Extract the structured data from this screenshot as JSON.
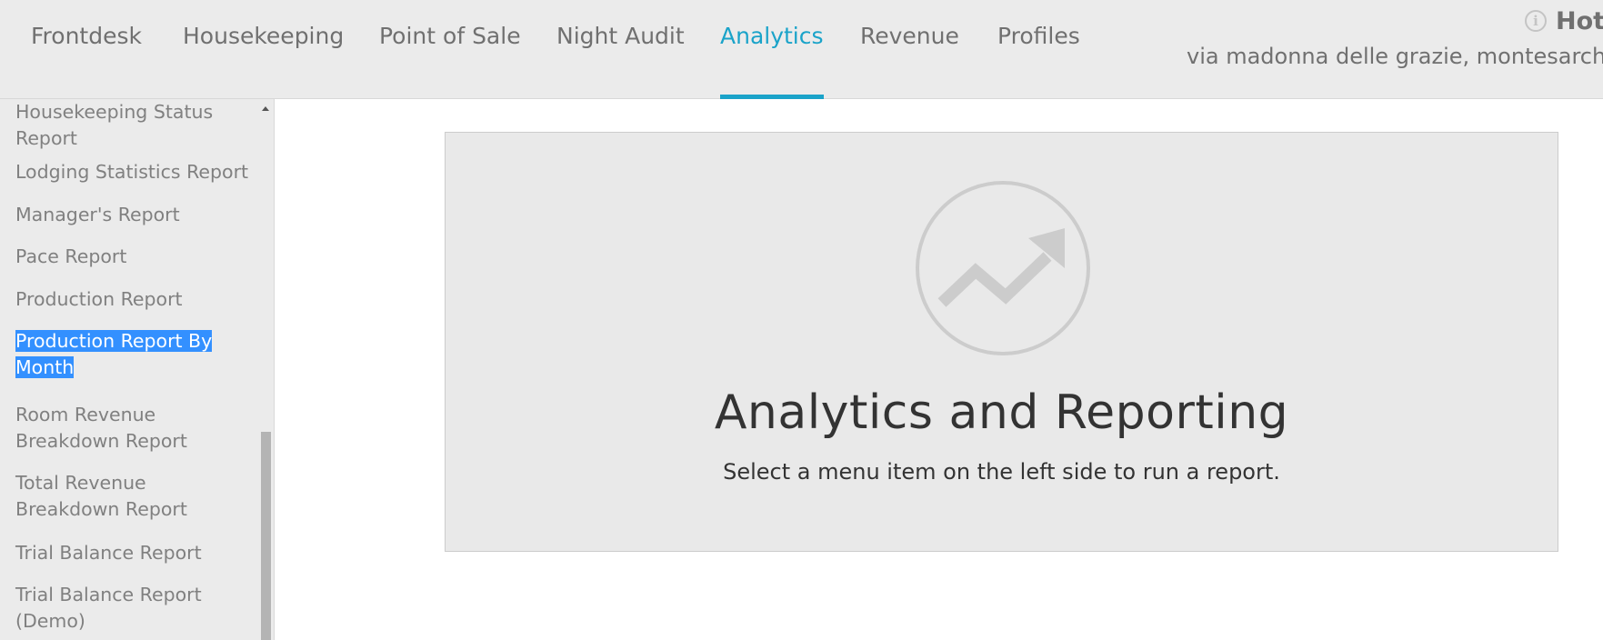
{
  "nav": {
    "tabs": [
      {
        "label": "Frontdesk",
        "active": false
      },
      {
        "label": "Housekeeping",
        "active": false
      },
      {
        "label": "Point of Sale",
        "active": false
      },
      {
        "label": "Night Audit",
        "active": false
      },
      {
        "label": "Analytics",
        "active": true
      },
      {
        "label": "Revenue",
        "active": false
      },
      {
        "label": "Profiles",
        "active": false
      }
    ],
    "accent_color": "#1aa3c9"
  },
  "hotel": {
    "name": "Hot",
    "address": "via madonna delle grazie, montesarchio",
    "info_icon": "info-icon"
  },
  "sidebar": {
    "items": [
      {
        "label": "Housekeeping Status Report"
      },
      {
        "label": "Lodging Statistics Report"
      },
      {
        "label": "Manager's Report"
      },
      {
        "label": "Pace Report"
      },
      {
        "label": "Production Report"
      },
      {
        "label": "Production Report By Month",
        "selected": true
      },
      {
        "label": "Room Revenue Breakdown Report"
      },
      {
        "label": "Total Revenue Breakdown Report"
      },
      {
        "label": "Trial Balance Report"
      },
      {
        "label": "Trial Balance Report (Demo)"
      }
    ]
  },
  "main": {
    "icon": "trending-up-icon",
    "title": "Analytics and Reporting",
    "subtitle": "Select a menu item on the left side to run a report."
  }
}
